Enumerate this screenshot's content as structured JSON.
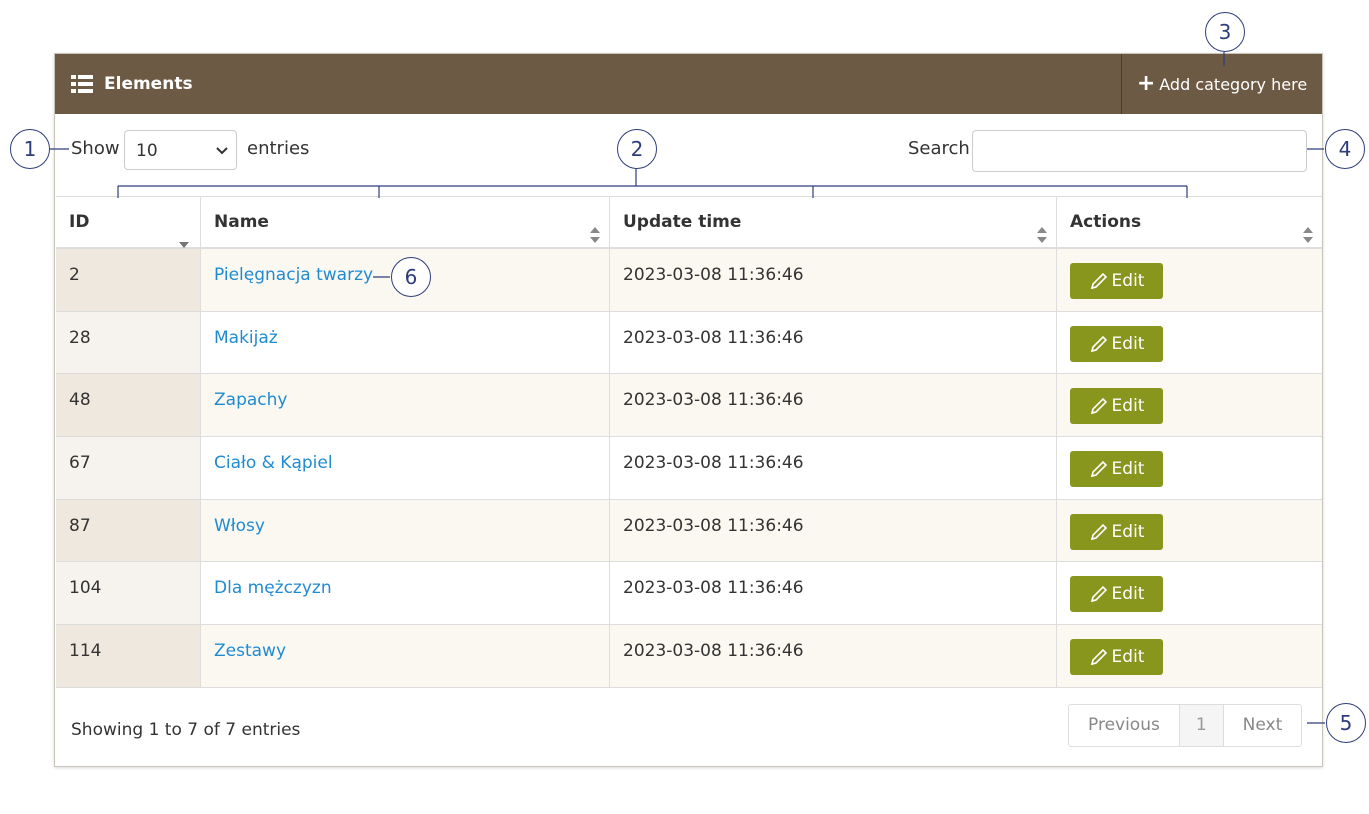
{
  "header": {
    "title": "Elements",
    "add_label": "Add category here"
  },
  "controls": {
    "show_label": "Show",
    "page_size": "10",
    "entries_label": "entries",
    "search_label": "Search:",
    "search_value": ""
  },
  "table": {
    "columns": [
      "ID",
      "Name",
      "Update time",
      "Actions"
    ],
    "rows": [
      {
        "id": "2",
        "name": "Pielęgnacja twarzy",
        "updated": "2023-03-08 11:36:46",
        "action": "Edit"
      },
      {
        "id": "28",
        "name": "Makijaż",
        "updated": "2023-03-08 11:36:46",
        "action": "Edit"
      },
      {
        "id": "48",
        "name": "Zapachy",
        "updated": "2023-03-08 11:36:46",
        "action": "Edit"
      },
      {
        "id": "67",
        "name": "Ciało & Kąpiel",
        "updated": "2023-03-08 11:36:46",
        "action": "Edit"
      },
      {
        "id": "87",
        "name": "Włosy",
        "updated": "2023-03-08 11:36:46",
        "action": "Edit"
      },
      {
        "id": "104",
        "name": "Dla mężczyzn",
        "updated": "2023-03-08 11:36:46",
        "action": "Edit"
      },
      {
        "id": "114",
        "name": "Zestawy",
        "updated": "2023-03-08 11:36:46",
        "action": "Edit"
      }
    ]
  },
  "footer": {
    "info": "Showing 1 to 7 of 7 entries",
    "prev": "Previous",
    "page": "1",
    "next": "Next"
  },
  "callouts": [
    "1",
    "2",
    "3",
    "4",
    "5",
    "6"
  ],
  "colors": {
    "header_bg": "#6c5a45",
    "edit_button": "#88961e",
    "link": "#1f8bd0",
    "callout": "#2e3c7a"
  }
}
